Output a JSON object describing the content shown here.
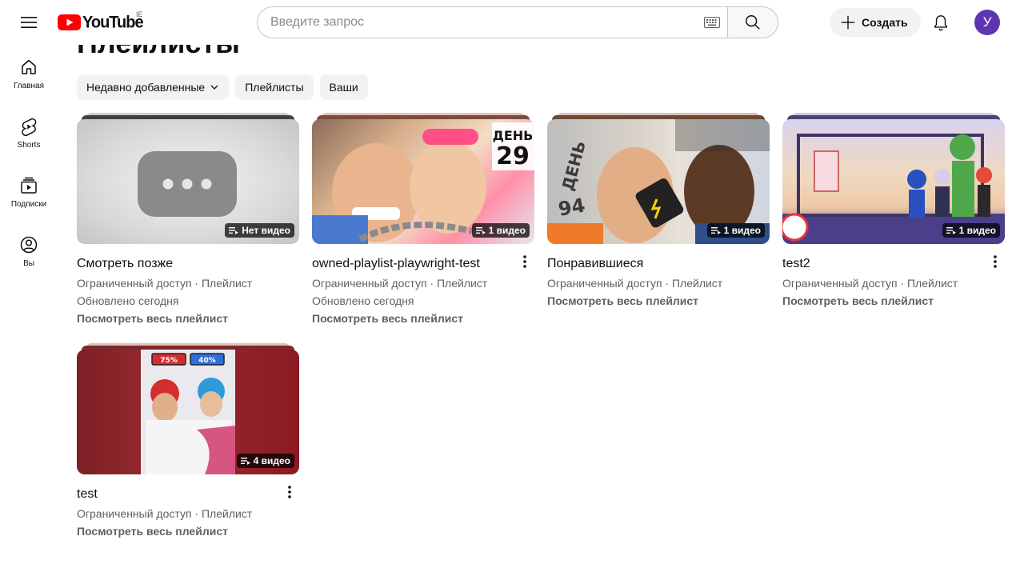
{
  "header": {
    "logo_text": "YouTube",
    "region": "IE",
    "search_placeholder": "Введите запрос",
    "create_label": "Создать",
    "avatar_letter": "У"
  },
  "sidebar": {
    "items": [
      {
        "label": "Главная",
        "icon": "home-icon"
      },
      {
        "label": "Shorts",
        "icon": "shorts-icon"
      },
      {
        "label": "Подписки",
        "icon": "subscriptions-icon"
      },
      {
        "label": "Вы",
        "icon": "you-icon"
      }
    ]
  },
  "main": {
    "title": "Плейлисты",
    "chips": [
      {
        "label": "Недавно добавленные"
      },
      {
        "label": "Плейлисты"
      },
      {
        "label": "Ваши"
      }
    ],
    "playlists": [
      {
        "title": "Смотреть позже",
        "access": "Ограниченный доступ · Плейлист",
        "updated": "Обновлено сегодня",
        "link": "Посмотреть весь плейлист",
        "badge": "Нет видео"
      },
      {
        "title": "owned-playlist-playwright-test",
        "access": "Ограниченный доступ · Плейлист",
        "updated": "Обновлено сегодня",
        "link": "Посмотреть весь плейлист",
        "badge": "1 видео",
        "thumb_text": "ДЕНЬ 29"
      },
      {
        "title": "Понравившиеся",
        "access": "Ограниченный доступ · Плейлист",
        "link": "Посмотреть весь плейлист",
        "badge": "1 видео",
        "thumb_text": "ДЕНЬ 94"
      },
      {
        "title": "test2",
        "access": "Ограниченный доступ · Плейлист",
        "link": "Посмотреть весь плейлист",
        "badge": "1 видео"
      },
      {
        "title": "test",
        "access": "Ограниченный доступ · Плейлист",
        "link": "Посмотреть весь плейлист",
        "badge": "4 видео",
        "thumb_left": "75%",
        "thumb_right": "40%"
      }
    ]
  },
  "colors": {
    "brand_red": "#ff0000",
    "avatar_bg": "#5e35b1",
    "chip_bg": "#f2f2f2"
  }
}
